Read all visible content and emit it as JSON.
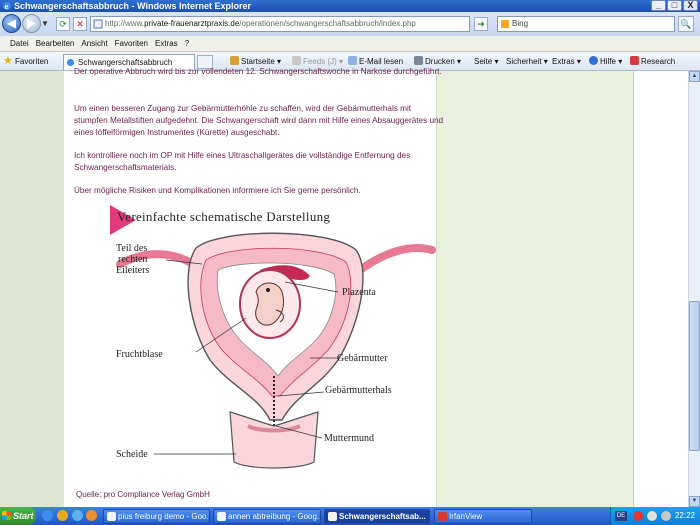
{
  "window": {
    "title": "Schwangerschaftsabbruch - Windows Internet Explorer",
    "controls": [
      "_",
      "□",
      "X"
    ]
  },
  "address": {
    "url_prefix": "http://www.",
    "url_domain": "private-frauenarztpraxis.de",
    "url_path": "/operationen/schwangerschaftsabbruch/index.php",
    "search_placeholder": "Bing"
  },
  "menu": [
    "Datei",
    "Bearbeiten",
    "Ansicht",
    "Favoriten",
    "Extras",
    "?"
  ],
  "favbar": {
    "favorites_label": "Favoriten",
    "tab_title": "Schwangerschaftsabbruch",
    "commands": {
      "home": "Startseite",
      "feeds": "Feeds (J)",
      "mail": "E-Mail lesen",
      "print": "Drucken",
      "page": "Seite",
      "safety": "Sicherheit",
      "tools": "Extras",
      "help": "Hilfe",
      "research": "Research"
    }
  },
  "content": {
    "paragraph_partial": "Der operative Abbruch wird bis zur vollendeten 12. Schwangerschaftswoche in Narkose durchgeführt.",
    "paragraph_2": "Um einen besseren Zugang zur Gebärmutterhöhle zu schaffen, wird der Gebärmutterhals mit stumpfen Metallstiften aufgedehnt. Die Schwangerschaft wird dann mit Hilfe eines Absauggerätes und eines löffelförmigen Instrumentes (Kürette) ausgeschabt.",
    "paragraph_3": "Ich kontrolliere noch im OP mit Hilfe eines Ultraschallgerätes die vollständige Entfernung des Schwangerschaftsmaterials.",
    "paragraph_4": "Über mögliche Risiken und Komplikationen informiere ich Sie gerne persönlich.",
    "credit": "Quelle: pro Compliance Verlag GmbH"
  },
  "diagram": {
    "title": "Vereinfachte schematische Darstellung",
    "labels": {
      "tube_line1": "Teil des",
      "tube_line2": "rechten",
      "tube_line3": "Eileiters",
      "placenta": "Plazenta",
      "sac": "Fruchtblase",
      "uterus": "Gebärmutter",
      "cervix": "Gebärmutterhals",
      "os": "Muttermund",
      "vagina": "Scheide"
    }
  },
  "taskbar": {
    "start": "Start",
    "tasks": [
      "pius freiburg demo - Goo...",
      "annen abtreibung - Goog...",
      "Schwangerschaftsab...",
      "IrfanView"
    ],
    "lang": "DE",
    "clock": "22:22"
  },
  "colors": {
    "text": "#6b1f4a",
    "accent_pink": "#e23b7d",
    "uterus_pink": "#f4a6b3"
  }
}
